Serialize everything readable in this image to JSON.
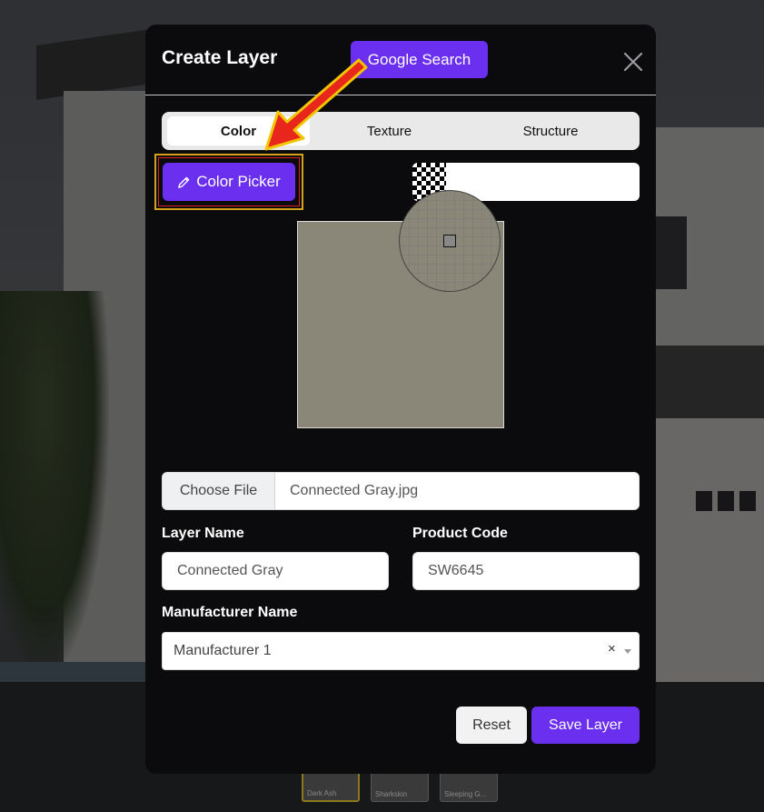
{
  "modal": {
    "title": "Create Layer",
    "google_search_label": "Google Search"
  },
  "tabs": [
    {
      "label": "Color",
      "active": true
    },
    {
      "label": "Texture",
      "active": false
    },
    {
      "label": "Structure",
      "active": false
    }
  ],
  "color": {
    "picker_label": "Color Picker",
    "hex_value": "",
    "swatch_color": "#8a8778"
  },
  "file": {
    "choose_label": "Choose File",
    "file_name": "Connected Gray.jpg"
  },
  "form": {
    "layer_name_label": "Layer Name",
    "layer_name_value": "Connected Gray",
    "product_code_label": "Product Code",
    "product_code_value": "SW6645",
    "manufacturer_label": "Manufacturer Name",
    "manufacturer_value": "Manufacturer 1",
    "clear_glyph": "×"
  },
  "actions": {
    "reset_label": "Reset",
    "save_label": "Save Layer"
  },
  "background_thumbs": [
    {
      "label": "Dark Ash"
    },
    {
      "label": "Sharkskin"
    },
    {
      "label": "Sleeping G..."
    }
  ],
  "colors": {
    "accent": "#6b2ff0",
    "annotation_arrow": "#e8261c",
    "annotation_outline": "#f2c500"
  }
}
